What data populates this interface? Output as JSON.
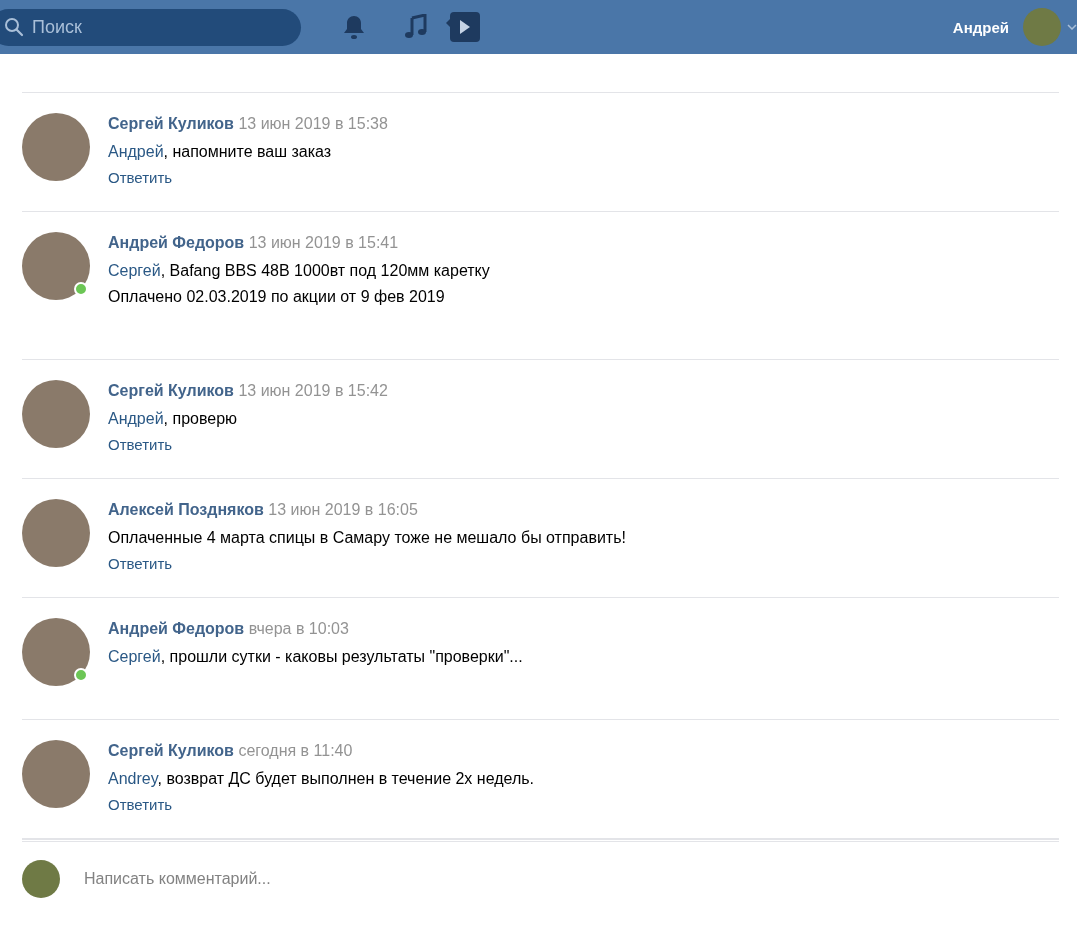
{
  "header": {
    "search": {
      "placeholder": "Поиск"
    },
    "user_name": "Андрей"
  },
  "comments": [
    {
      "author": "Сергей Куликов",
      "date": "13 июн 2019 в 15:38",
      "mention": "Андрей",
      "lines": [
        ", напомните ваш заказ"
      ],
      "reply": "Ответить",
      "online": false
    },
    {
      "author": "Андрей Федоров",
      "date": "13 июн 2019 в 15:41",
      "mention": "Сергей",
      "lines": [
        ", Bafang BBS 48В 1000вт под 120мм каретку",
        "Оплачено 02.03.2019 по акции от 9 фев 2019"
      ],
      "online": true
    },
    {
      "author": "Сергей Куликов",
      "date": "13 июн 2019 в 15:42",
      "mention": "Андрей",
      "lines": [
        ", проверю"
      ],
      "reply": "Ответить",
      "online": false
    },
    {
      "author": "Алексей Поздняков",
      "date": "13 июн 2019 в 16:05",
      "lines": [
        "Оплаченные 4 марта спицы в Самару тоже не мешало бы отправить!"
      ],
      "reply": "Ответить",
      "online": false
    },
    {
      "author": "Андрей Федоров",
      "date": "вчера в 10:03",
      "mention": "Сергей",
      "lines": [
        ", прошли сутки - каковы результаты \"проверки\"..."
      ],
      "online": true
    },
    {
      "author": "Сергей Куликов",
      "date": "сегодня в 11:40",
      "mention": "Andrey",
      "lines": [
        ", возврат ДС будет выполнен в течение 2х недель."
      ],
      "reply": "Ответить",
      "online": false
    }
  ],
  "composer": {
    "placeholder": "Написать комментарий..."
  }
}
